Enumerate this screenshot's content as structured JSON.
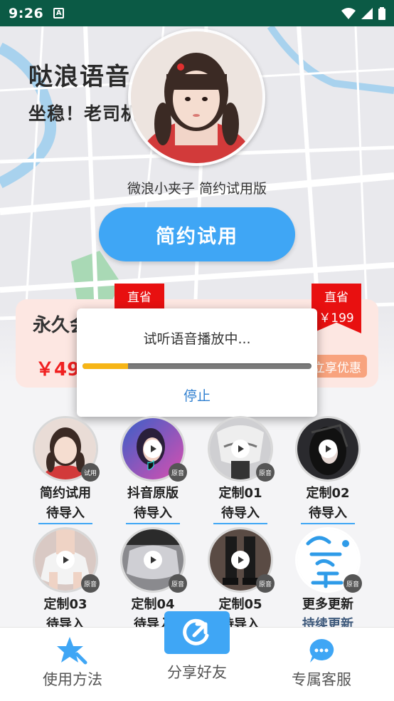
{
  "status_bar": {
    "time": "9:26",
    "notification_icon": "A"
  },
  "header": {
    "title": "哒浪语音",
    "subtitle": "坐稳！老司机",
    "avatar_name": "微浪小夹子 简约试用版"
  },
  "trial_button": {
    "label": "简约试用"
  },
  "pricing": {
    "title": "永久会员",
    "price": "￥49",
    "ribbon_left": "直省",
    "ribbon_right": "直省",
    "ribbon_right_sub": "￥199",
    "enjoy_label": "立享优惠"
  },
  "dialog": {
    "message": "试听语音播放中...",
    "stop_label": "停止",
    "progress": 0.2
  },
  "voices": [
    {
      "name": "简约试用",
      "status": "待导入",
      "badge": "试用"
    },
    {
      "name": "抖音原版",
      "status": "待导入",
      "badge": "原音"
    },
    {
      "name": "定制01",
      "status": "待导入",
      "badge": "原音"
    },
    {
      "name": "定制02",
      "status": "待导入",
      "badge": "原音"
    },
    {
      "name": "定制03",
      "status": "待导入",
      "badge": "原音"
    },
    {
      "name": "定制04",
      "status": "待导入",
      "badge": "原音"
    },
    {
      "name": "定制05",
      "status": "待导入",
      "badge": "原音"
    },
    {
      "name": "更多更新",
      "status": "持续更新",
      "badge": "原音"
    }
  ],
  "bottom_nav": {
    "left": "使用方法",
    "center": "分享好友",
    "right": "专属客服"
  },
  "colors": {
    "accent": "#3fa6f5",
    "status_bar": "#0b5a45",
    "ribbon": "#e81010",
    "progress": "#f6b516",
    "price": "#f02020"
  }
}
